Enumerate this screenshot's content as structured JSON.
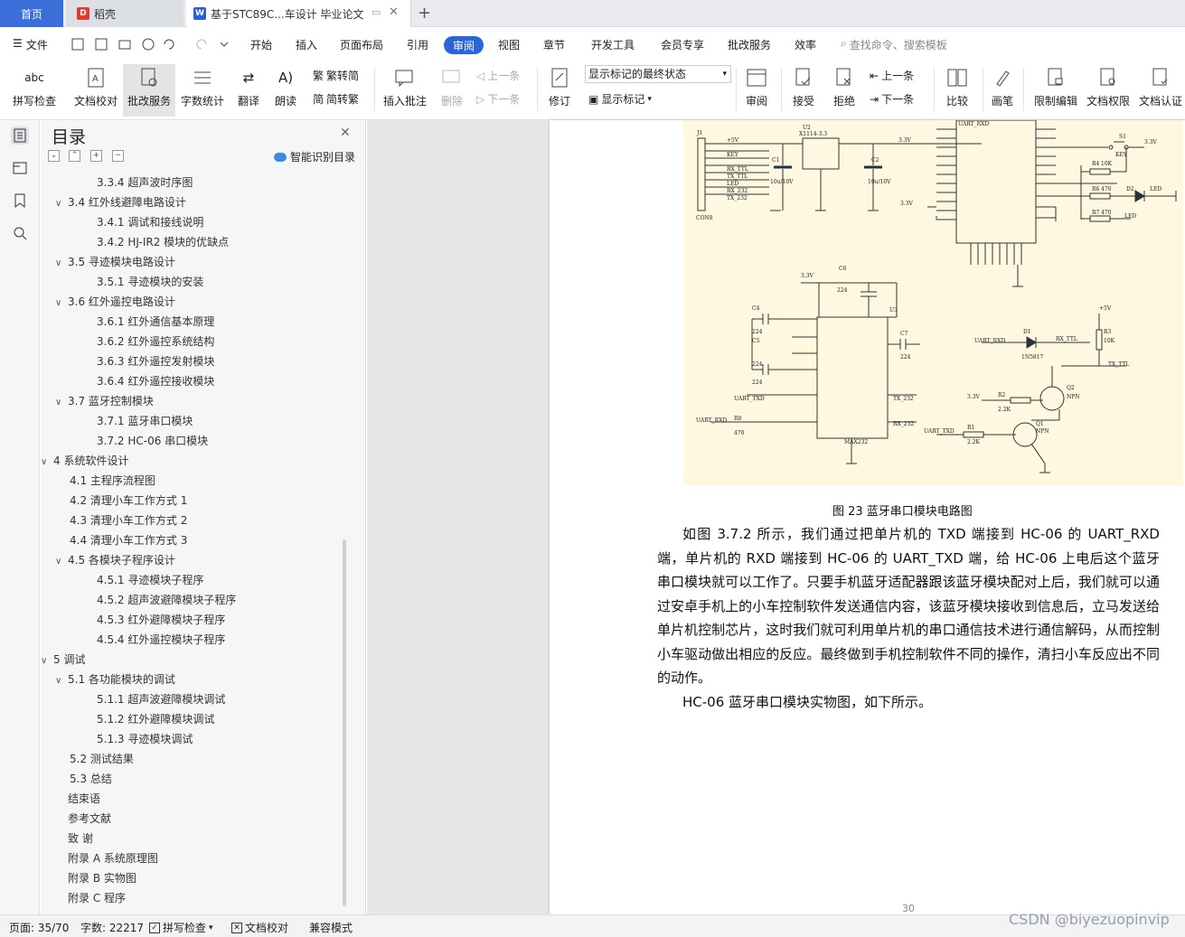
{
  "tabs": {
    "home": "首页",
    "daoke": "稻壳",
    "doc": "基于STC89C...车设计 毕业论文"
  },
  "menu": {
    "file": "文件",
    "items": [
      "开始",
      "插入",
      "页面布局",
      "引用",
      "审阅",
      "视图",
      "章节",
      "开发工具",
      "会员专享",
      "批改服务",
      "效率"
    ],
    "search": "查找命令、搜索模板"
  },
  "toolbar": {
    "spell": "拼写检查",
    "proof": "文档校对",
    "correct": "批改服务",
    "count": "字数统计",
    "translate": "翻译",
    "read": "朗读",
    "to_trad": "繁转简",
    "to_simp": "简转繁",
    "add_comment": "插入批注",
    "delete": "删除",
    "prev": "上一条",
    "next": "下一条",
    "revise": "修订",
    "markup_state": "显示标记的最终状态",
    "show_markup": "显示标记",
    "review": "审阅",
    "accept": "接受",
    "reject": "拒绝",
    "prev2": "上一条",
    "next2": "下一条",
    "compare": "比较",
    "pen": "画笔",
    "restrict": "限制编辑",
    "perm": "文档权限",
    "cert": "文档认证"
  },
  "toc": {
    "title": "目录",
    "smart": "智能识别目录",
    "items": [
      {
        "text": "3.3.4  超声波时序图",
        "level": 3
      },
      {
        "text": "3.4  红外线避障电路设计",
        "level": 2,
        "caret": "∨"
      },
      {
        "text": "3.4.1  调试和接线说明",
        "level": 3
      },
      {
        "text": "3.4.2 HJ-IR2 模块的优缺点",
        "level": 3
      },
      {
        "text": "3.5  寻迹模块电路设计",
        "level": 2,
        "caret": "∨"
      },
      {
        "text": "3.5.1  寻迹模块的安装",
        "level": 3
      },
      {
        "text": "3.6  红外遥控电路设计",
        "level": 2,
        "caret": "∨"
      },
      {
        "text": "3.6.1  红外通信基本原理",
        "level": 3
      },
      {
        "text": "3.6.2  红外遥控系统结构",
        "level": 3
      },
      {
        "text": "3.6.3  红外遥控发射模块",
        "level": 3
      },
      {
        "text": "3.6.4  红外遥控接收模块",
        "level": 3
      },
      {
        "text": "3.7  蓝牙控制模块",
        "level": 2,
        "caret": "∨"
      },
      {
        "text": "3.7.1  蓝牙串口模块",
        "level": 3
      },
      {
        "text": "3.7.2 HC-06 串口模块",
        "level": 3
      },
      {
        "text": "4  系统软件设计",
        "level": 1,
        "caret": "∨"
      },
      {
        "text": "4.1  主程序流程图",
        "level": 2
      },
      {
        "text": "4.2  清理小车工作方式 1",
        "level": 2
      },
      {
        "text": "4.3  清理小车工作方式 2",
        "level": 2
      },
      {
        "text": "4.4  清理小车工作方式 3",
        "level": 2
      },
      {
        "text": "4.5  各模块子程序设计",
        "level": 2,
        "caret": "∨"
      },
      {
        "text": "4.5.1  寻迹模块子程序",
        "level": 3
      },
      {
        "text": "4.5.2  超声波避障模块子程序",
        "level": 3
      },
      {
        "text": "4.5.3  红外避障模块子程序",
        "level": 3
      },
      {
        "text": "4.5.4  红外遥控模块子程序",
        "level": 3
      },
      {
        "text": "5  调试",
        "level": 1,
        "caret": "∨"
      },
      {
        "text": "5.1  各功能模块的调试",
        "level": 2,
        "caret": "∨"
      },
      {
        "text": "5.1.1  超声波避障模块调试",
        "level": 3
      },
      {
        "text": "5.1.2  红外避障模块调试",
        "level": 3
      },
      {
        "text": "5.1.3  寻迹模块调试",
        "level": 3
      },
      {
        "text": "5.2  测试结果",
        "level": 2
      },
      {
        "text": "5.3  总结",
        "level": 2
      },
      {
        "text": "结束语",
        "level": 1
      },
      {
        "text": "参考文献",
        "level": 1
      },
      {
        "text": "致    谢",
        "level": 1
      },
      {
        "text": "附录 A    系统原理图",
        "level": 1
      },
      {
        "text": "附录 B    实物图",
        "level": 1
      },
      {
        "text": "附录 C    程序",
        "level": 1
      }
    ]
  },
  "document": {
    "caption": "图 23  蓝牙串口模块电路图",
    "para1": "如图 3.7.2 所示，我们通过把单片机的 TXD 端接到 HC-06 的 UART_RXD 端，单片机的 RXD 端接到 HC-06 的 UART_TXD 端，给 HC-06 上电后这个蓝牙串口模块就可以工作了。只要手机蓝牙适配器跟该蓝牙模块配对上后，我们就可以通过安卓手机上的小车控制软件发送通信内容，该蓝牙模块接收到信息后，立马发送给单片机控制芯片，这时我们就可利用单片机的串口通信技术进行通信解码，从而控制小车驱动做出相应的反应。最终做到手机控制软件不同的操作，清扫小车反应出不同的动作。",
    "para2": "HC-06 蓝牙串口模块实物图，如下所示。",
    "page_number": "30",
    "circuit_labels": {
      "u2": "U2",
      "u2_part": "X1114-3.3",
      "j1": "J1",
      "con8": "CON8",
      "c1": "C1",
      "c1_val": "10u/10V",
      "c2": "C2",
      "c2_val": "10u/10V",
      "v33": "3.3V",
      "v5": "+5V",
      "u3": "U3",
      "max": "MAX232",
      "c4": "C4",
      "c5": "C5",
      "c6": "C6",
      "c7": "C7",
      "cap": "224",
      "d1": "D1",
      "d1_part": "1N5817",
      "r3": "R3",
      "r3_val": "10K",
      "q1": "Q1",
      "q2": "Q2",
      "npn": "NPN",
      "r1": "R1",
      "r2": "R2",
      "r_val": "2.2K",
      "uart_rxd": "UART_RXD",
      "uart_txd": "UART_TXD",
      "rx_ttl": "RX_TTL",
      "tx_ttl": "TX_TTL",
      "rx232": "RX_232",
      "tx232": "TX_232",
      "r8": "R8",
      "r8_val": "470",
      "s1": "S1",
      "key": "KEY",
      "led": "LED",
      "d2": "D2",
      "r4": "R4",
      "r4_val": "10K",
      "r6": "R6",
      "r6_val": "470",
      "r7": "R7",
      "r7_val": "470"
    }
  },
  "status": {
    "page": "页面: 35/70",
    "words": "字数: 22217",
    "spell": "拼写检查",
    "proof": "文档校对",
    "compat": "兼容模式"
  },
  "watermark": "CSDN @biyezuopinvip",
  "colors": {
    "accent": "#2a66d8",
    "home_tab": "#3b6ed9",
    "circuit_bg": "#fdf8df"
  }
}
